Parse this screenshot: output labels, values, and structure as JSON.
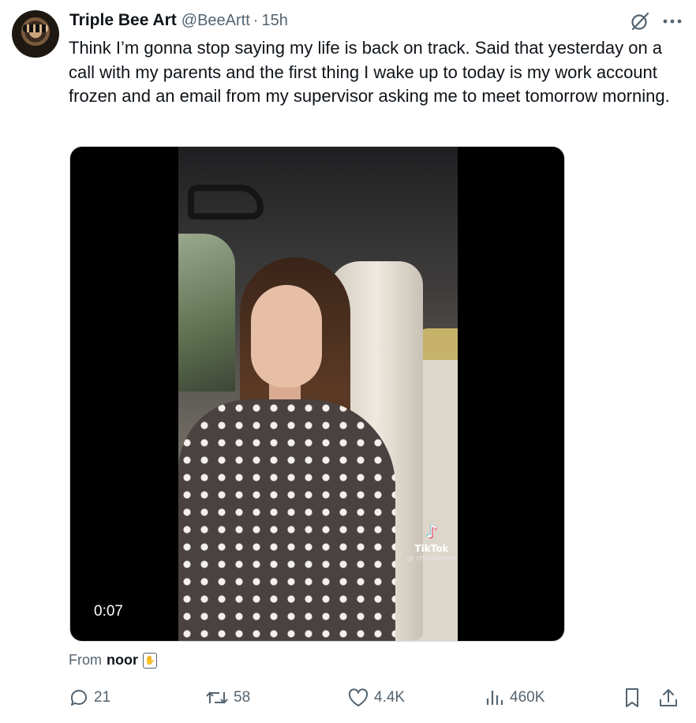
{
  "tweet": {
    "display_name": "Triple Bee Art",
    "handle": "@BeeArtt",
    "separator": "·",
    "time": "15h",
    "text": "Think I’m gonna stop saying my life is back on track. Said that yesterday on a call with my parents and the first thing I wake up to today is my work account frozen and an email from my supervisor asking me to meet tomorrow morning."
  },
  "media": {
    "duration": "0:07",
    "watermark_brand": "TikTok",
    "watermark_user": "@ chloeforero"
  },
  "attribution": {
    "prefix": "From",
    "name": "noor"
  },
  "actions": {
    "replies": "21",
    "reposts": "58",
    "likes": "4.4K",
    "views": "460K"
  },
  "icons": {
    "top_right": [
      "grok-icon",
      "more-icon"
    ],
    "actions": [
      "reply-icon",
      "repost-icon",
      "like-icon",
      "views-icon",
      "bookmark-icon",
      "share-icon"
    ]
  },
  "colors": {
    "text_primary": "#0f1419",
    "text_secondary": "#536471",
    "border": "#cfd9de"
  }
}
